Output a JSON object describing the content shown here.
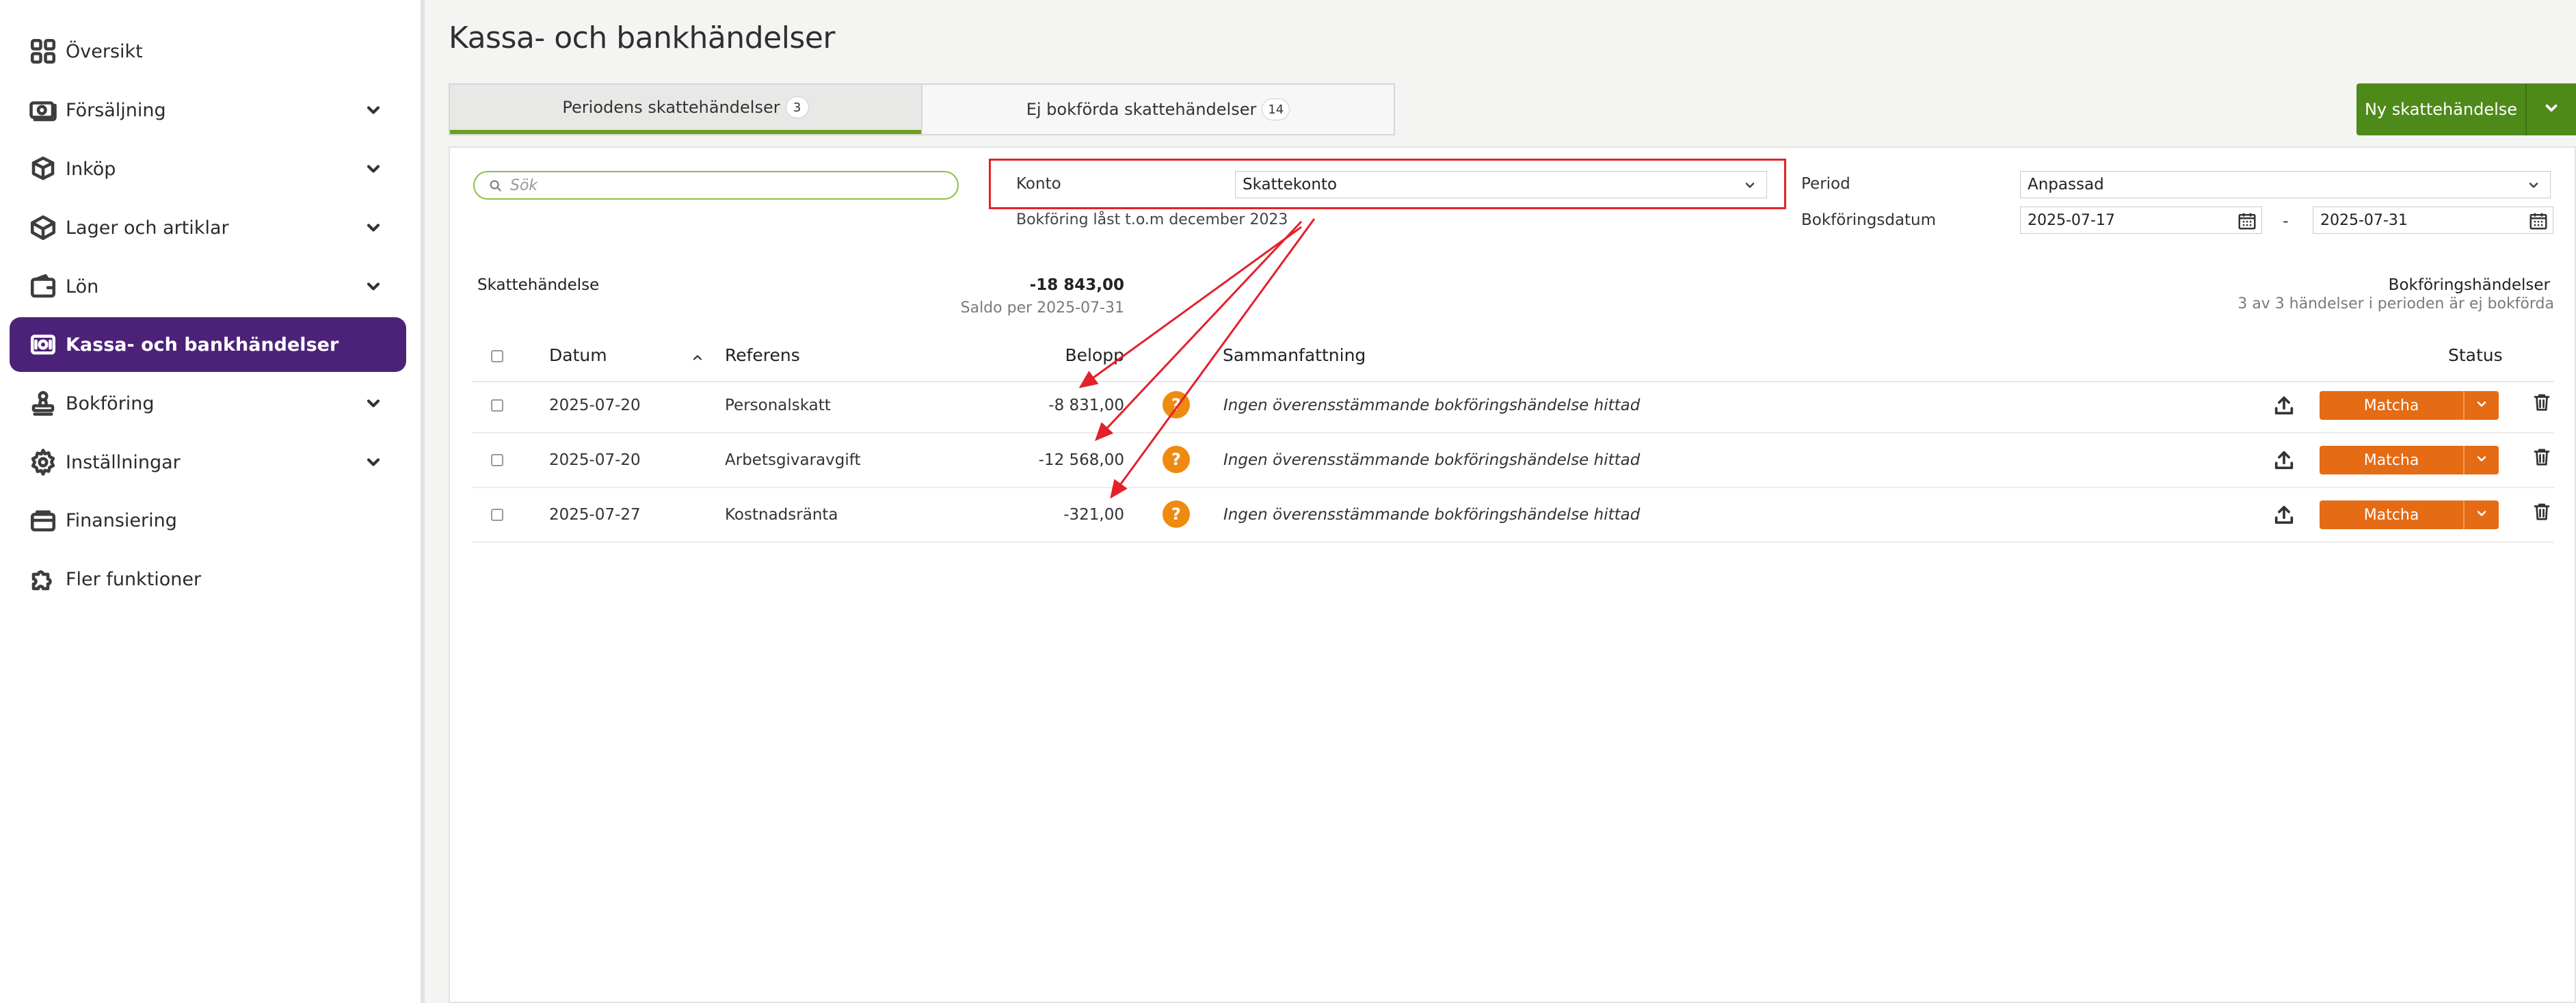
{
  "sidebar": {
    "items": [
      {
        "label": "Översikt",
        "icon": "grid-icon",
        "has_chevron": false
      },
      {
        "label": "Försäljning",
        "icon": "money-icon",
        "has_chevron": true
      },
      {
        "label": "Inköp",
        "icon": "boxes-icon",
        "has_chevron": true
      },
      {
        "label": "Lager och artiklar",
        "icon": "box-icon",
        "has_chevron": true
      },
      {
        "label": "Lön",
        "icon": "wallet-icon",
        "has_chevron": true
      },
      {
        "label": "Kassa- och bankhändelser",
        "icon": "cash-icon",
        "has_chevron": false,
        "active": true
      },
      {
        "label": "Bokföring",
        "icon": "stamp-icon",
        "has_chevron": true
      },
      {
        "label": "Inställningar",
        "icon": "gear-icon",
        "has_chevron": true
      },
      {
        "label": "Finansiering",
        "icon": "finance-icon",
        "has_chevron": false
      },
      {
        "label": "Fler funktioner",
        "icon": "puzzle-icon",
        "has_chevron": false
      }
    ]
  },
  "header": {
    "title": "Kassa- och bankhändelser",
    "new_button_label": "Ny skattehändelse"
  },
  "tabs": [
    {
      "label": "Periodens skattehändelser",
      "count": "3",
      "active": true
    },
    {
      "label": "Ej bokförda skattehändelser",
      "count": "14",
      "active": false
    }
  ],
  "filters": {
    "search_placeholder": "Sök",
    "konto_label": "Konto",
    "konto_value": "Skattekonto",
    "lock_note": "Bokföring låst t.o.m december 2023",
    "period_label": "Period",
    "period_value": "Anpassad",
    "date_label": "Bokföringsdatum",
    "date_from": "2025-07-17",
    "date_separator": "-",
    "date_to": "2025-07-31"
  },
  "summary": {
    "left_title": "Skattehändelse",
    "amount": "-18 843,00",
    "saldo": "Saldo per 2025-07-31",
    "right_title": "Bokföringshändelser",
    "right_sub": "3 av 3 händelser i perioden är ej bokförda"
  },
  "table": {
    "headers": {
      "date": "Datum",
      "reference": "Referens",
      "amount": "Belopp",
      "summary": "Sammanfattning",
      "status": "Status"
    },
    "rows": [
      {
        "date": "2025-07-20",
        "reference": "Personalskatt",
        "amount": "-8 831,00",
        "summary": "Ingen överensstämmande bokföringshändelse hittad",
        "action": "Matcha"
      },
      {
        "date": "2025-07-20",
        "reference": "Arbetsgivaravgift",
        "amount": "-12 568,00",
        "summary": "Ingen överensstämmande bokföringshändelse hittad",
        "action": "Matcha"
      },
      {
        "date": "2025-07-27",
        "reference": "Kostnadsränta",
        "amount": "-321,00",
        "summary": "Ingen överensstämmande bokföringshändelse hittad",
        "action": "Matcha"
      }
    ],
    "status_icon": "?"
  },
  "colors": {
    "sidebar_active": "#4b2278",
    "primary_green": "#4e8a1a",
    "match_orange": "#e56b14",
    "annotation_red": "#e4202a"
  }
}
